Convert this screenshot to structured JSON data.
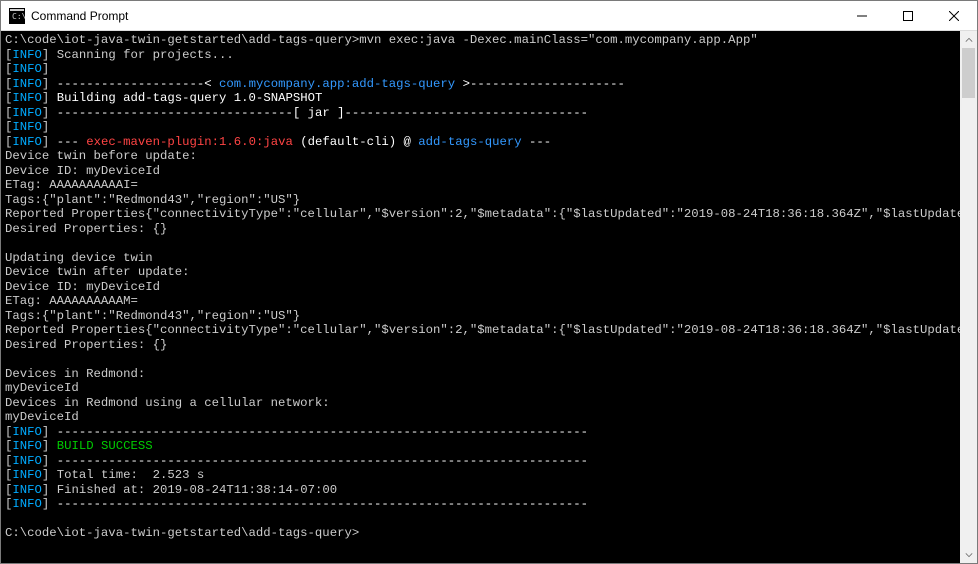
{
  "window": {
    "title": "Command Prompt"
  },
  "terminal": {
    "prompt1": "C:\\code\\iot-java-twin-getstarted\\add-tags-query>",
    "cmd1": "mvn exec:java -Dexec.mainClass=\"com.mycompany.app.App\"",
    "bracket_l": "[",
    "bracket_r": "]",
    "info": "INFO",
    "scanning": " Scanning for projects...",
    "blank_info": "",
    "dashes72": " ------------------------------------------------------------------------",
    "mod_open": " --------------------< ",
    "mod_name": "com.mycompany.app:add-tags-query",
    "mod_close": " >---------------------",
    "building": " Building add-tags-query 1.0-SNAPSHOT",
    "jar_line": " --------------------------------[ jar ]---------------------------------",
    "plugin_pre": " --- ",
    "plugin": "exec-maven-plugin:1.6.0:java",
    "plugin_mid": " (default-cli) @ ",
    "plugin_target": "add-tags-query",
    "plugin_post": " ---",
    "body": "Device twin before update:\nDevice ID: myDeviceId\nETag: AAAAAAAAAAI=\nTags:{\"plant\":\"Redmond43\",\"region\":\"US\"}\nReported Properties{\"connectivityType\":\"cellular\",\"$version\":2,\"$metadata\":{\"$lastUpdated\":\"2019-08-24T18:36:18.364Z\",\"$lastUpdatedVersion\":null,\"connectivityType\":{\"$lastUpdated\":\"2019-08-24T18:36:18.364Z\"}}}\nDesired Properties: {}\n\nUpdating device twin\nDevice twin after update:\nDevice ID: myDeviceId\nETag: AAAAAAAAAAM=\nTags:{\"plant\":\"Redmond43\",\"region\":\"US\"}\nReported Properties{\"connectivityType\":\"cellular\",\"$version\":2,\"$metadata\":{\"$lastUpdated\":\"2019-08-24T18:36:18.364Z\",\"$lastUpdatedVersion\":null,\"connectivityType\":{\"$lastUpdated\":\"2019-08-24T18:36:18.364Z\"}}}\nDesired Properties: {}\n\nDevices in Redmond:\nmyDeviceId\nDevices in Redmond using a cellular network:\nmyDeviceId",
    "build_success": "BUILD SUCCESS",
    "total_time": " Total time:  2.523 s",
    "finished_at": " Finished at: 2019-08-24T11:38:14-07:00",
    "prompt2": "C:\\code\\iot-java-twin-getstarted\\add-tags-query>"
  }
}
